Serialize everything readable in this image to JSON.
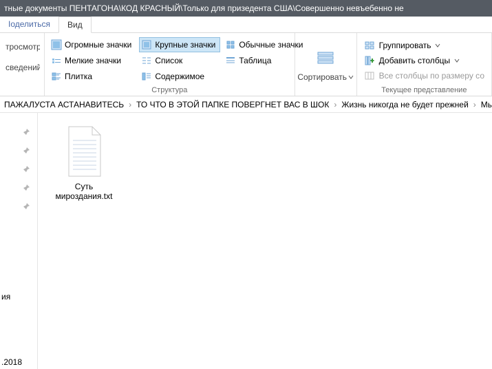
{
  "titlebar": "тные документы ПЕНТАГОНА\\КОД КРАСНЫЙ\\Только для призедента США\\Совершенно невъебенно не",
  "tabs": {
    "share": "Іоделиться",
    "view": "Вид"
  },
  "ribbon": {
    "preview": {
      "row1": "тросмотра",
      "row2": "сведений"
    },
    "layout": {
      "huge": "Огромные значки",
      "large": "Крупные значки",
      "normal": "Обычные значки",
      "small": "Мелкие значки",
      "list": "Список",
      "table": "Таблица",
      "tiles": "Плитка",
      "content": "Содержимое",
      "caption": "Структура"
    },
    "sort": {
      "label": "Сортировать"
    },
    "arrange": {
      "group": "Группировать",
      "addcols": "Добавить столбцы",
      "fitcols": "Все столбцы по размеру со",
      "caption": "Текущее представление"
    }
  },
  "breadcrumb": {
    "seg1": "ПАЖАЛУСТА АСТАНАВИТЕСЬ",
    "seg2": "ТО ЧТО В ЭТОЙ ПАПКЕ ПОВЕРГНЕТ ВАС В ШОК",
    "seg3": "Жизнь никогда не будет прежней",
    "seg4": "Мы в"
  },
  "file": {
    "name": "Суть мироздания.txt"
  },
  "sidetext": {
    "one": "ия",
    "two": ".2018"
  }
}
